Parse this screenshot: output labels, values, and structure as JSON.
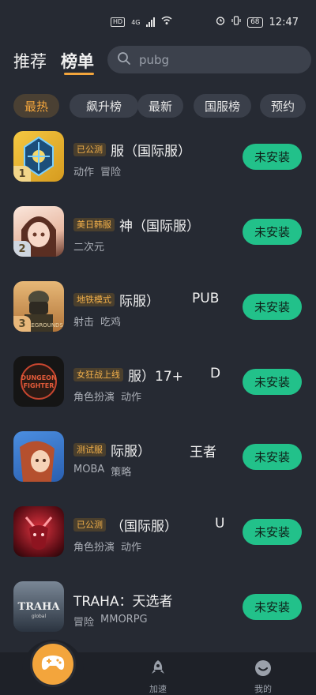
{
  "status_bar": {
    "hd_badge": "HD",
    "net_badge": "4G",
    "time": "12:47",
    "battery": "68"
  },
  "header": {
    "tabs": [
      {
        "label": "推荐",
        "active": false
      },
      {
        "label": "榜单",
        "active": true
      }
    ],
    "search_placeholder": "pubg",
    "search_icon": "search-icon"
  },
  "filters": [
    {
      "label": "最热",
      "active": true
    },
    {
      "label": "飙升榜",
      "active": false
    },
    {
      "label": "最新",
      "active": false
    },
    {
      "label": "国服榜",
      "active": false
    },
    {
      "label": "预约",
      "active": false
    }
  ],
  "games": [
    {
      "rank": "1",
      "badge": "已公测",
      "name": "服（国际服）",
      "tags": [
        "动作",
        "冒险"
      ],
      "button": "未安装",
      "icon_colors": [
        "#f2b62e",
        "#1c4e7a"
      ]
    },
    {
      "rank": "2",
      "badge": "美日韩服",
      "name": "神（国际服）",
      "tags": [
        "二次元"
      ],
      "button": "未安装",
      "icon_colors": [
        "#f5d9c9",
        "#6a3b2e"
      ]
    },
    {
      "rank": "3",
      "badge": "地铁模式",
      "name": "际服）",
      "name2": "PUB",
      "tags": [
        "射击",
        "吃鸡"
      ],
      "button": "未安装",
      "icon_colors": [
        "#d99a4a",
        "#3b2e22"
      ]
    },
    {
      "rank": "",
      "badge": "女狂战上线",
      "name": "服）17+",
      "name2": "D",
      "tags": [
        "角色扮演",
        "动作"
      ],
      "button": "未安装",
      "icon_colors": [
        "#1a1a1a",
        "#c5452f"
      ]
    },
    {
      "rank": "",
      "badge": "测试服",
      "name": "际服）",
      "name2": "王者",
      "tags": [
        "MOBA",
        "策略"
      ],
      "button": "未安装",
      "icon_colors": [
        "#3a7bd5",
        "#f0a15a"
      ]
    },
    {
      "rank": "",
      "badge": "已公测",
      "name": "（国际服）",
      "name2": "U",
      "tags": [
        "角色扮演",
        "动作"
      ],
      "button": "未安装",
      "icon_colors": [
        "#b3202c",
        "#3a0e12"
      ]
    },
    {
      "rank": "",
      "badge": "",
      "name": "TRAHA：天选者",
      "tags": [
        "冒险",
        "MMORPG"
      ],
      "button": "未安装",
      "icon_colors": [
        "#6b7a8a",
        "#2b3440"
      ],
      "icon_text": "TRAHA",
      "icon_subtext": "global"
    }
  ],
  "bottom_nav": [
    {
      "label": "",
      "icon": "gamepad-icon"
    },
    {
      "label": "加速",
      "icon": "rocket-icon"
    },
    {
      "label": "我的",
      "icon": "smiley-icon"
    }
  ],
  "colors": {
    "background": "#262a33",
    "accent": "#f3a53c",
    "install": "#22c18a"
  }
}
